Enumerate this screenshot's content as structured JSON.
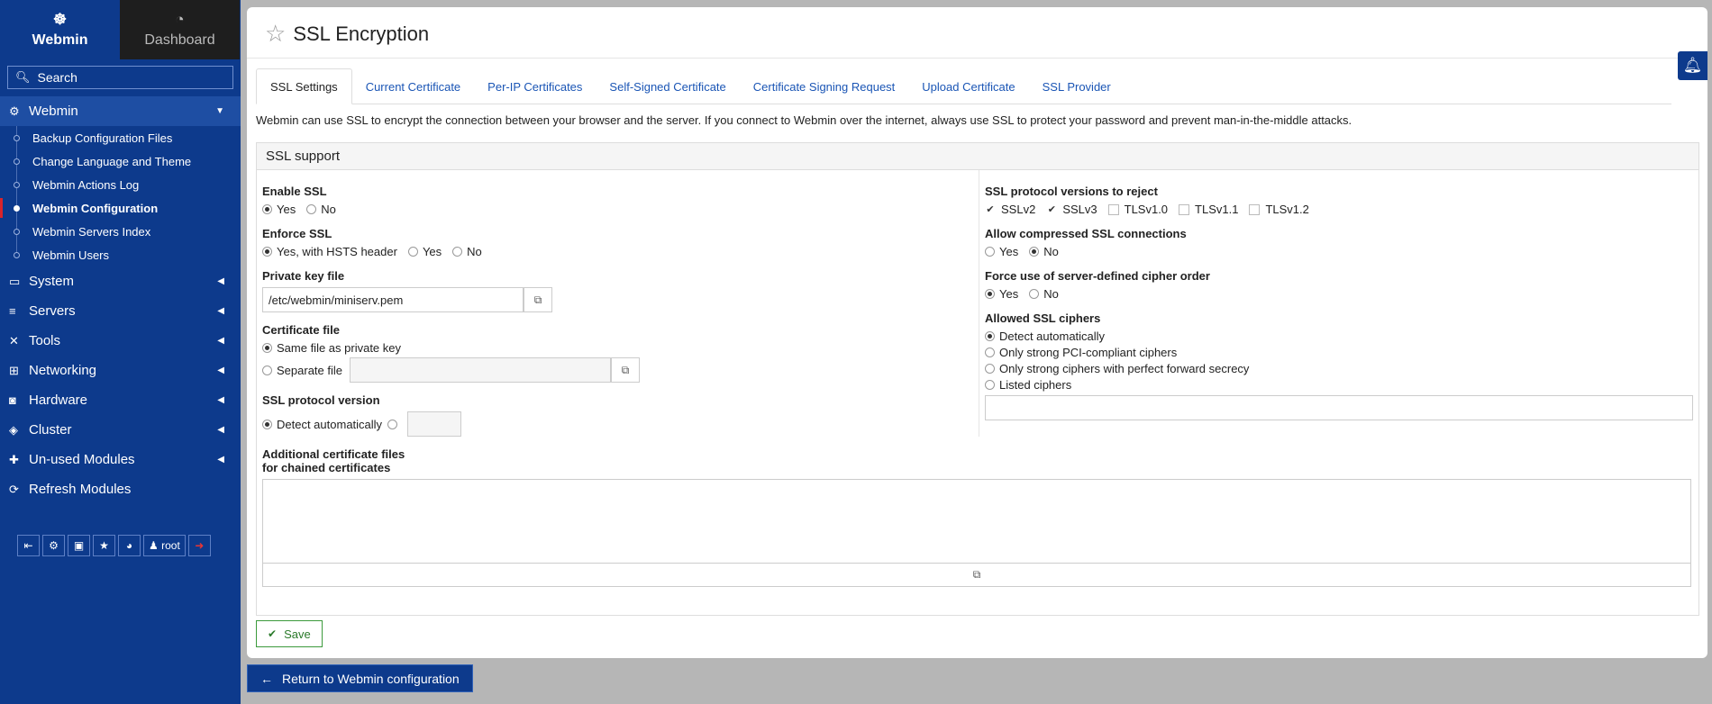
{
  "sidebar": {
    "tabs": [
      {
        "label": "Webmin",
        "icon": "webmin-logo-icon"
      },
      {
        "label": "Dashboard",
        "icon": "gauge-icon"
      }
    ],
    "search_placeholder": "Search",
    "webmin_category": "Webmin",
    "webmin_items": [
      "Backup Configuration Files",
      "Change Language and Theme",
      "Webmin Actions Log",
      "Webmin Configuration",
      "Webmin Servers Index",
      "Webmin Users"
    ],
    "categories": [
      {
        "label": "System",
        "icon": "laptop-icon",
        "glyph": "💻"
      },
      {
        "label": "Servers",
        "icon": "server-icon",
        "glyph": "≡"
      },
      {
        "label": "Tools",
        "icon": "wrench-icon",
        "glyph": "✕"
      },
      {
        "label": "Networking",
        "icon": "network-icon",
        "glyph": "☍"
      },
      {
        "label": "Hardware",
        "icon": "hdd-icon",
        "glyph": "◙"
      },
      {
        "label": "Cluster",
        "icon": "layers-icon",
        "glyph": "◈"
      },
      {
        "label": "Un-used Modules",
        "icon": "puzzle-icon",
        "glyph": "✚"
      },
      {
        "label": "Refresh Modules",
        "icon": "refresh-icon",
        "glyph": "⟳"
      }
    ],
    "user": "root"
  },
  "header": {
    "title": "SSL Encryption"
  },
  "tabs": [
    "SSL Settings",
    "Current Certificate",
    "Per-IP Certificates",
    "Self-Signed Certificate",
    "Certificate Signing Request",
    "Upload Certificate",
    "SSL Provider"
  ],
  "description": "Webmin can use SSL to encrypt the connection between your browser and the server. If you connect to Webmin over the internet, always use SSL to protect your password and prevent man-in-the-middle attacks.",
  "panel": {
    "title": "SSL support",
    "enable_ssl": {
      "label": "Enable SSL",
      "yes": "Yes",
      "no": "No"
    },
    "enforce_ssl": {
      "label": "Enforce SSL",
      "hsts": "Yes, with HSTS header",
      "yes": "Yes",
      "no": "No"
    },
    "private_key": {
      "label": "Private key file",
      "value": "/etc/webmin/miniserv.pem"
    },
    "cert_file": {
      "label": "Certificate file",
      "same": "Same file as private key",
      "separate": "Separate file"
    },
    "protocol_version": {
      "label": "SSL protocol version",
      "auto": "Detect automatically"
    },
    "additional": {
      "label1": "Additional certificate files",
      "label2": "for chained certificates"
    },
    "reject_versions": {
      "label": "SSL protocol versions to reject",
      "options": [
        "SSLv2",
        "SSLv3",
        "TLSv1.0",
        "TLSv1.1",
        "TLSv1.2"
      ],
      "checked": [
        true,
        true,
        false,
        false,
        false
      ]
    },
    "compressed": {
      "label": "Allow compressed SSL connections",
      "yes": "Yes",
      "no": "No"
    },
    "cipher_order": {
      "label": "Force use of server-defined cipher order",
      "yes": "Yes",
      "no": "No"
    },
    "ciphers": {
      "label": "Allowed SSL ciphers",
      "options": [
        "Detect automatically",
        "Only strong PCI-compliant ciphers",
        "Only strong ciphers with perfect forward secrecy",
        "Listed ciphers"
      ]
    }
  },
  "buttons": {
    "save": "Save",
    "return": "Return to Webmin configuration"
  },
  "colors": {
    "sidebar": "#0d3a8c",
    "link": "#1a55b5",
    "save": "#2a7a2a"
  }
}
